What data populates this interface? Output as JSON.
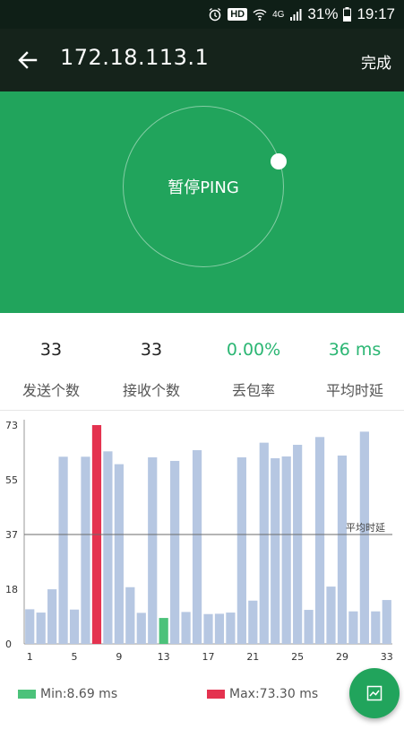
{
  "status_bar": {
    "hd_badge": "HD",
    "network": "4G",
    "battery": "31%",
    "time": "19:17",
    "icons": [
      "alarm-icon",
      "hd-icon",
      "wifi-icon",
      "signal-icon",
      "battery-icon"
    ]
  },
  "app_bar": {
    "title": "172.18.113.1",
    "done_label": "完成",
    "back_icon": "arrow-left-icon"
  },
  "ping_control": {
    "label": "暂停PING"
  },
  "stats": {
    "sent": {
      "value": "33",
      "label": "发送个数"
    },
    "received": {
      "value": "33",
      "label": "接收个数"
    },
    "loss": {
      "value": "0.00%",
      "label": "丢包率"
    },
    "avg": {
      "value": "36 ms",
      "label": "平均时延"
    }
  },
  "colors": {
    "accent_green": "#21a45c",
    "bar": "#b6c7e2",
    "max_bar": "#e4324f",
    "min_bar": "#4cc27a",
    "stat_green": "#2bb673"
  },
  "chart_data": {
    "type": "bar",
    "x": [
      1,
      2,
      3,
      4,
      5,
      6,
      7,
      8,
      9,
      10,
      11,
      12,
      13,
      14,
      15,
      16,
      17,
      18,
      19,
      20,
      21,
      22,
      23,
      24,
      25,
      26,
      27,
      28,
      29,
      30,
      31,
      32,
      33
    ],
    "values": [
      11.6,
      10.5,
      18.3,
      62.7,
      11.5,
      62.7,
      73.3,
      64.5,
      60.2,
      19.0,
      10.4,
      62.5,
      8.69,
      61.3,
      10.7,
      64.9,
      10.0,
      10.1,
      10.5,
      62.5,
      14.5,
      67.4,
      62.2,
      62.8,
      66.7,
      11.4,
      69.3,
      19.2,
      63.1,
      10.9,
      71.1,
      10.9,
      14.7
    ],
    "ytick_labels": [
      "0",
      "18",
      "37",
      "55",
      "73"
    ],
    "ytick_values": [
      0,
      18.3,
      36.65,
      54.98,
      73.3
    ],
    "xtick_labels": [
      "1",
      "5",
      "9",
      "13",
      "17",
      "21",
      "25",
      "29",
      "33"
    ],
    "ylim": [
      0,
      73.3
    ],
    "avg_line": {
      "value": 36.65,
      "label": "平均时延"
    },
    "max_index": 6,
    "min_index": 12,
    "legend": [
      {
        "name": "Min:8.69 ms",
        "color": "#4cc27a"
      },
      {
        "name": "Max:73.30 ms",
        "color": "#e4324f"
      }
    ]
  },
  "fab": {
    "icon": "chart-icon"
  }
}
